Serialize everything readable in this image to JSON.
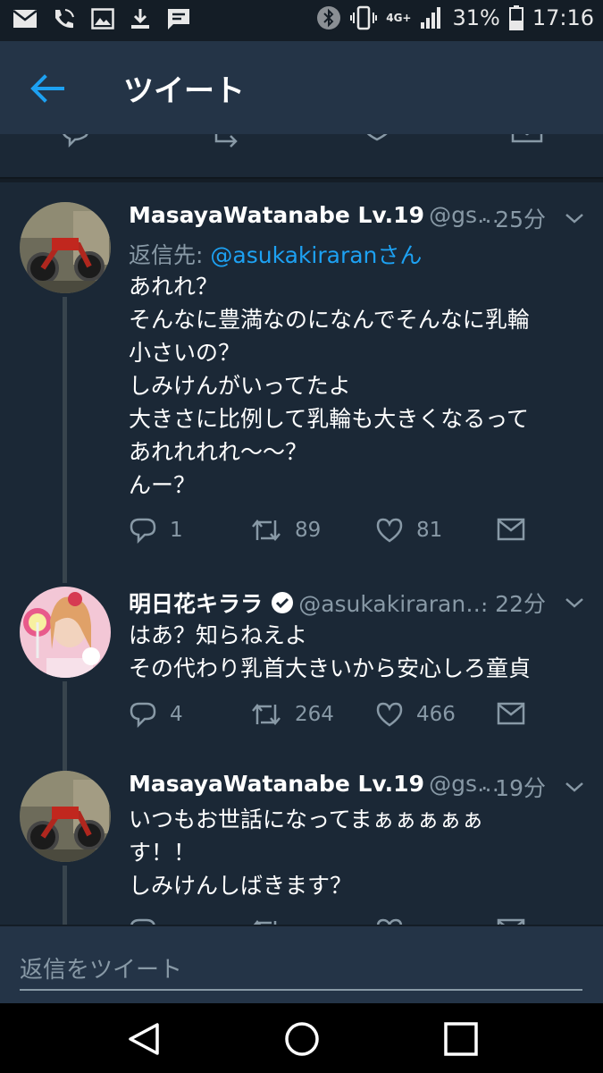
{
  "status_bar": {
    "battery_percent": "31%",
    "clock": "17:16",
    "network": "4G+",
    "icons": [
      "mail-icon",
      "phone-call-icon",
      "image-icon",
      "download-icon",
      "message-icon",
      "bluetooth-icon",
      "vibrate-icon",
      "signal-icon",
      "battery-icon"
    ]
  },
  "header": {
    "title": "ツイート",
    "back_icon": "arrow-left-icon"
  },
  "tweets": [
    {
      "display_name": "MasayaWatanabe Lv.19",
      "handle": "@gs…",
      "time": "· 25分",
      "reply_to_label": "返信先: ",
      "reply_to_mention": "@asukakiraranさん",
      "lines": [
        "あれれ？",
        "そんなに豊満なのになんでそんなに乳輪",
        "小さいの？",
        "しみけんがいってたよ",
        "大きさに比例して乳輪も大きくなるって",
        "あれれれれ〜〜？",
        "んー？"
      ],
      "replies": "1",
      "retweets": "89",
      "likes": "81"
    },
    {
      "display_name": "明日花キララ",
      "handle": "@asukakiraran…",
      "time": "· 22分",
      "verified": true,
      "lines": [
        "はあ？知らねえよ",
        "その代わり乳首大きいから安心しろ童貞"
      ],
      "replies": "4",
      "retweets": "264",
      "likes": "466"
    },
    {
      "display_name": "MasayaWatanabe Lv.19",
      "handle": "@gs…",
      "time": "· 19分",
      "lines": [
        "いつもお世話になってまぁぁぁぁぁ",
        "す！！",
        "しみけんしばきます？"
      ]
    }
  ],
  "composer": {
    "placeholder": "返信をツイート"
  },
  "colors": {
    "background": "#1b2836",
    "header": "#243447",
    "accent": "#1da1f2",
    "muted": "#8899a6",
    "thread_line": "#38444d"
  }
}
